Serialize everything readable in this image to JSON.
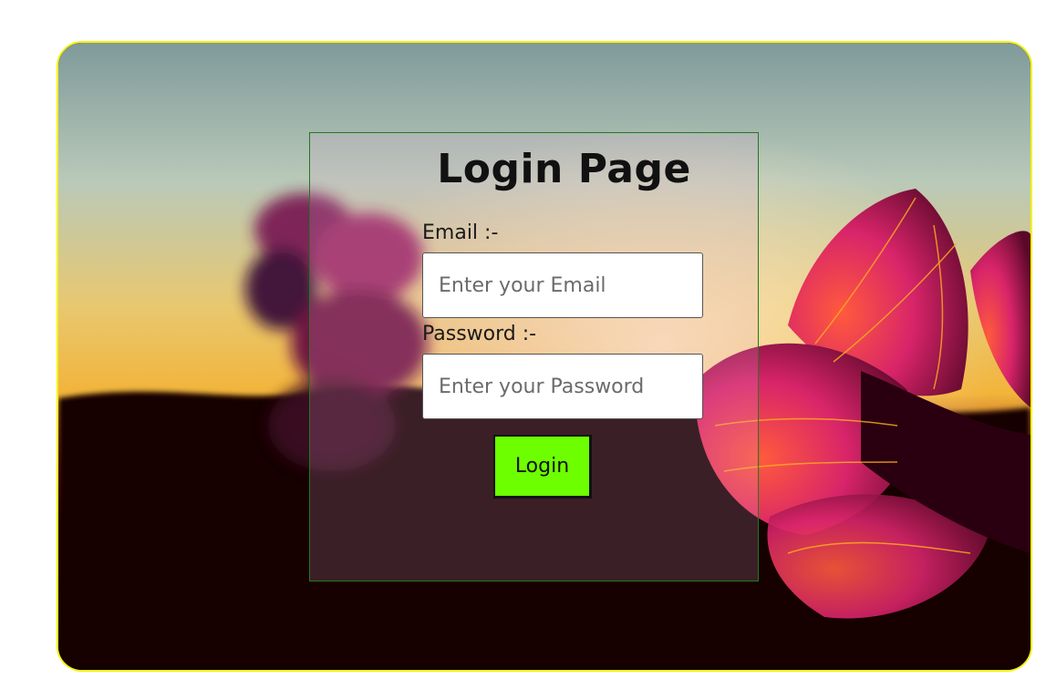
{
  "page": {
    "frame_border_color": "#f5f10a"
  },
  "background": {
    "description_icon": "sunset-flower-photo",
    "sky_top_color": "#8ea8a8",
    "sky_glow_color": "#f2c43a",
    "flower_color": "#d8246a",
    "ground_color": "#120008"
  },
  "login": {
    "title": "Login Page",
    "email_label": "Email :-",
    "email_placeholder": "Enter your Email",
    "email_value": "",
    "password_label": "Password :-",
    "password_placeholder": "Enter your Password",
    "password_value": "",
    "button_label": "Login",
    "button_color": "#6dff00",
    "panel_border_color": "#1f7a1f"
  }
}
